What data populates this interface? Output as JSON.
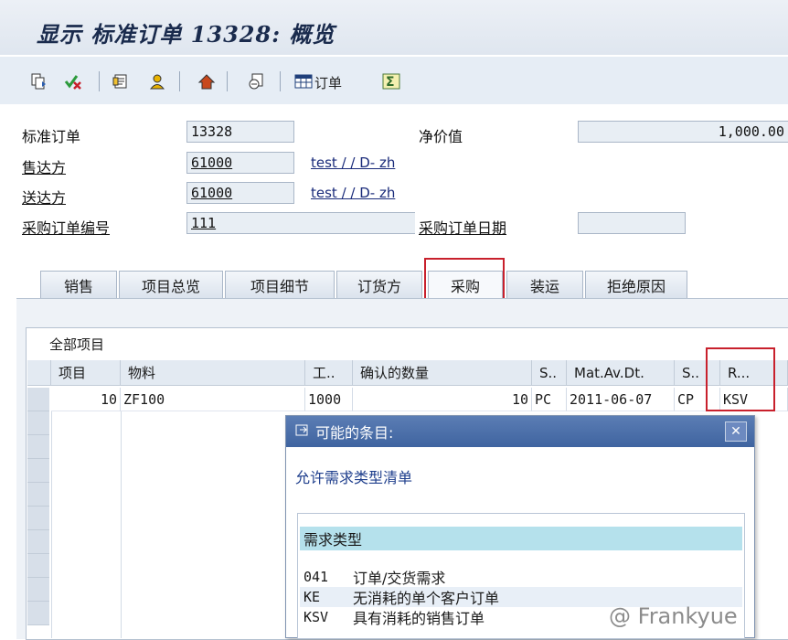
{
  "window": {
    "title": "显示 标准订单 13328: 概览"
  },
  "toolbar": {
    "order_label": "订单"
  },
  "header": {
    "std_order_label": "标准订单",
    "std_order_value": "13328",
    "net_value_label": "净价值",
    "net_value": "1,000.00",
    "sold_to_label": "售达方",
    "sold_to_value": "61000",
    "sold_to_name": "test / / D- zh",
    "ship_to_label": "送达方",
    "ship_to_value": "61000",
    "ship_to_name": "test / / D- zh",
    "po_number_label": "采购订单编号",
    "po_number_value": "111",
    "po_date_label": "采购订单日期",
    "po_date_value": ""
  },
  "tabs": [
    "销售",
    "项目总览",
    "项目细节",
    "订货方",
    "采购",
    "装运",
    "拒绝原因"
  ],
  "grid": {
    "caption": "全部项目",
    "columns": [
      "项目",
      "物料",
      "工..",
      "确认的数量",
      "S..",
      "Mat.Av.Dt.",
      "S..",
      "R..."
    ],
    "rows": [
      {
        "item": "10",
        "material": "ZF100",
        "plant": "1000",
        "qty": "10",
        "unit": "PC",
        "date": "2011-06-07",
        "cat": "CP",
        "req": "KSV"
      }
    ]
  },
  "popup": {
    "title": "可能的条目:",
    "subtitle": "允许需求类型清单",
    "list_header": "需求类型",
    "rows": [
      {
        "code": "041",
        "text": "订单/交货需求"
      },
      {
        "code": "KE",
        "text": "无消耗的单个客户订单"
      },
      {
        "code": "KSV",
        "text": "具有消耗的销售订单"
      }
    ]
  },
  "watermark": "@ Frankyue",
  "colors": {
    "accent_red": "#c8202c",
    "popup_title": "#3f64a0",
    "list_header": "#b5e1ec"
  }
}
